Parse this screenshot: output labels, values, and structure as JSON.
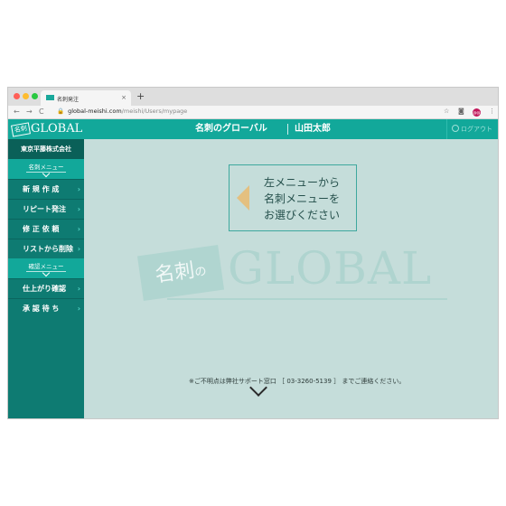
{
  "browser": {
    "tab_title": "名刺発注",
    "new_tab": "+",
    "tab_close": "×",
    "back": "←",
    "forward": "→",
    "reload": "C",
    "lock": "🔒",
    "url_host": "global-meishi.com",
    "url_path": "/meishi/Users/mypage",
    "star": "☆",
    "camera": "◙",
    "menu": "⋮",
    "avatar": "@@"
  },
  "sidebar": {
    "logo_badge": "名刺",
    "logo_text": "GLOBAL",
    "company": "東京平藤株式会社",
    "sections": [
      {
        "label": "名刺メニュー",
        "items": [
          "新 規 作 成",
          "リピート発注",
          "修 正 依 頼",
          "リストから削除"
        ]
      },
      {
        "label": "確認メニュー",
        "items": [
          "仕上がり確認",
          "承 認 待 ち"
        ]
      }
    ],
    "arrow": "›"
  },
  "header": {
    "title": "名刺のグローバル",
    "user": "山田太郎",
    "logout": "ログアウト"
  },
  "main": {
    "guide_lines": [
      "左メニューから",
      "名刺メニューを",
      "お選びください"
    ],
    "watermark_badge": "名刺",
    "watermark_no": "の",
    "watermark_text": "GLOBAL",
    "footnote": "※ご不明点は弊社サポート窓口 ［ 03-3260-5139 ］ までご連絡ください。"
  },
  "colors": {
    "teal": "#12a89a",
    "dark_teal": "#0e7b72",
    "page_bg": "#c5ddda",
    "arrow_gold": "#e4c080"
  }
}
